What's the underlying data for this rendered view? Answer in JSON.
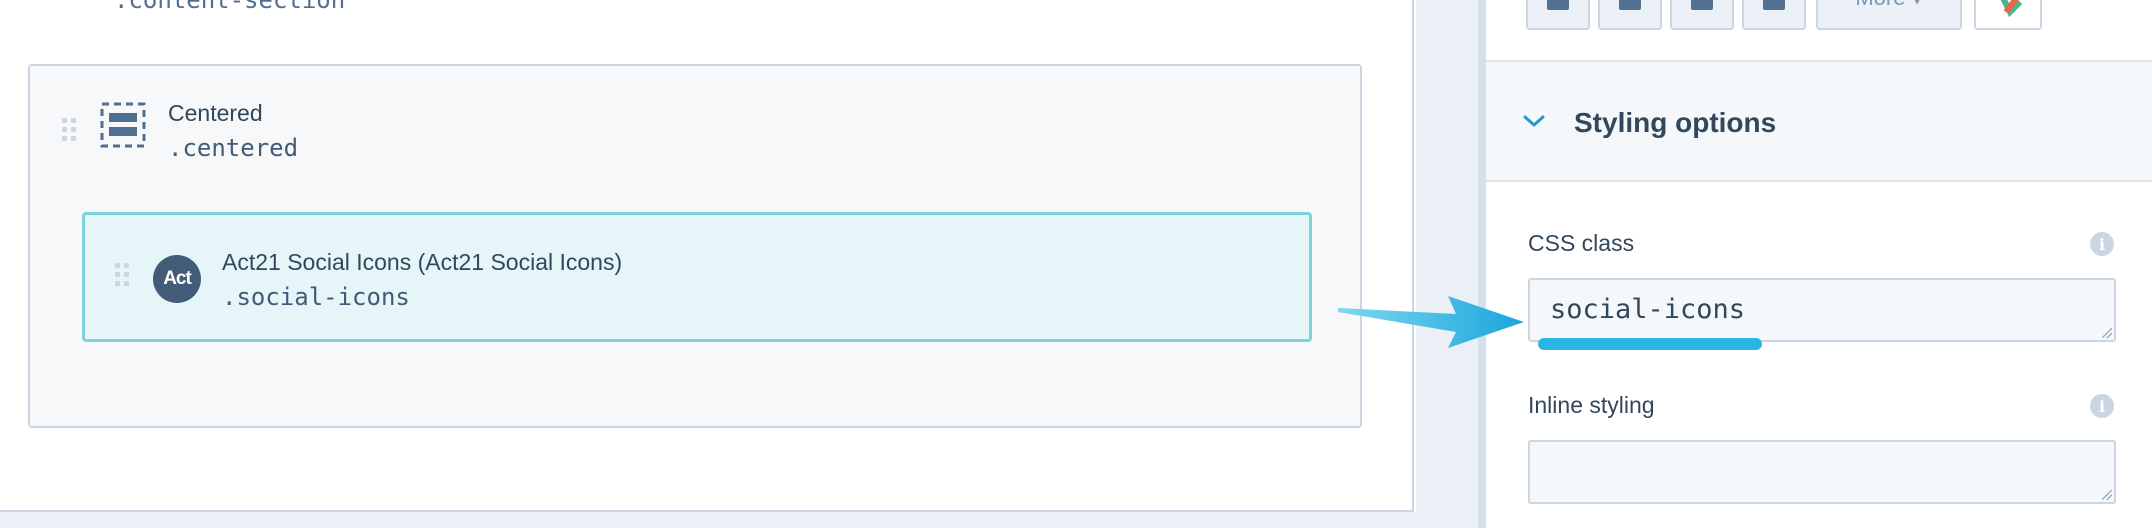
{
  "canvas": {
    "top_label": ".content-section",
    "section": {
      "title": "Centered",
      "class_name": ".centered"
    },
    "module": {
      "avatar_text": "Act",
      "title": "Act21 Social Icons (Act21 Social Icons)",
      "class_name": ".social-icons"
    }
  },
  "panel": {
    "toolbar": {
      "more_label": "More ▾"
    },
    "styling": {
      "title": "Styling options",
      "css_class": {
        "label": "CSS class",
        "value": "social-icons",
        "info": "i"
      },
      "inline_styling": {
        "label": "Inline styling",
        "value": "",
        "info": "i"
      }
    }
  },
  "colors": {
    "accent_teal": "#7fd1de",
    "module_bg": "#e5f5f8",
    "arrow_blue": "#29b6e5",
    "text_dark": "#33475b"
  }
}
